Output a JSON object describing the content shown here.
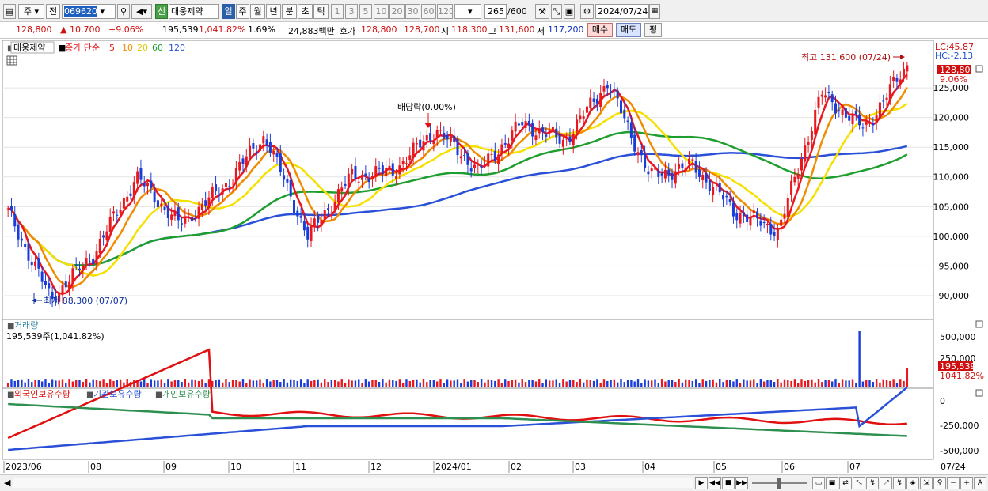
{
  "toolbar": {
    "market": "주",
    "prev": "전",
    "code": "069620",
    "stock_name": "대웅제약",
    "new_badge": "신",
    "periods": [
      "일",
      "주",
      "월",
      "년",
      "분",
      "초",
      "틱"
    ],
    "active_period": "일",
    "intervals": [
      "1",
      "3",
      "5",
      "10",
      "20",
      "30",
      "60",
      "120"
    ],
    "count": "265",
    "total": "/600",
    "date": "2024/07/24"
  },
  "quote": {
    "price": "128,800",
    "change": "▲ 10,700",
    "change_pct": "+9.06%",
    "volume": "195,539",
    "volume_ratio": "1,041.82%",
    "turnover": "1.69%",
    "amount": "24,883백만",
    "bid_label": "호가",
    "ask": "128,800",
    "bid": "128,700",
    "open_label": "시",
    "open": "118,300",
    "high_label": "고",
    "high": "131,600",
    "low_label": "저",
    "low": "117,200",
    "buy": "매수",
    "sell": "매도",
    "eval": "평"
  },
  "price_panel": {
    "stock_label": "대웅제약",
    "ma_label": "종가 단순",
    "ma_periods": [
      "5",
      "10",
      "20",
      "60",
      "120"
    ],
    "lc": "LC:45.87",
    "hc": "HC:-2.13",
    "last_price": "128,800",
    "last_pct": "9.06%",
    "high_annotation": "최고 131,600 (07/24)",
    "low_annotation": "최저 88,300 (07/07)",
    "dividend_annotation": "배당락(0.00%)"
  },
  "volume_panel": {
    "title": "거래량",
    "subtitle": "195,539주(1,041.82%)",
    "last_volume": "195,539",
    "last_ratio": "1041.82%"
  },
  "holding_panel": {
    "labels": [
      "외국인보유수량",
      "기관보유수량",
      "개인보유수량"
    ]
  },
  "colors": {
    "up": "#e8181e",
    "down": "#1a3cd8",
    "ma5": "#e8181e",
    "ma10": "#f08c00",
    "ma20": "#f5e000",
    "ma60": "#1e9e2e",
    "ma120": "#2a50d8",
    "foreign": "#e01010",
    "institution": "#2a50d8",
    "individual": "#2e9050"
  },
  "chart_data": {
    "type": "candlestick",
    "x_ticks": [
      "2023/06",
      "08",
      "09",
      "10",
      "11",
      "12",
      "2024/01",
      "02",
      "03",
      "04",
      "05",
      "06",
      "07",
      "07/24"
    ],
    "y_ticks": [
      90000,
      95000,
      100000,
      105000,
      110000,
      115000,
      120000,
      125000
    ],
    "ylim": [
      86000,
      133000
    ],
    "close_series_approx": [
      {
        "date": "2023/06",
        "close": 104000
      },
      {
        "date": "2023/07/07",
        "close": 89500
      },
      {
        "date": "2023/07",
        "close": 97000
      },
      {
        "date": "2023/08",
        "close": 110000
      },
      {
        "date": "2023/09",
        "close": 102000
      },
      {
        "date": "2023/09/late",
        "close": 108000
      },
      {
        "date": "2023/10",
        "close": 117000
      },
      {
        "date": "2023/11",
        "close": 100000
      },
      {
        "date": "2023/11/late",
        "close": 110000
      },
      {
        "date": "2023/12",
        "close": 111000
      },
      {
        "date": "2023/12/late",
        "close": 118000
      },
      {
        "date": "2024/01",
        "close": 111000
      },
      {
        "date": "2024/02",
        "close": 119000
      },
      {
        "date": "2024/03",
        "close": 116000
      },
      {
        "date": "2024/03/late",
        "close": 126000
      },
      {
        "date": "2024/04",
        "close": 110000
      },
      {
        "date": "2024/05",
        "close": 112000
      },
      {
        "date": "2024/06",
        "close": 104000
      },
      {
        "date": "2024/07/01",
        "close": 101000
      },
      {
        "date": "2024/07/10",
        "close": 124000
      },
      {
        "date": "2024/07/23",
        "close": 118100
      },
      {
        "date": "2024/07/24",
        "close": 128800
      }
    ],
    "volume_axis_ticks": [
      "500,000",
      "250,000"
    ],
    "holding_axis_ticks": [
      "0",
      "-250,000",
      "-500,000"
    ]
  }
}
